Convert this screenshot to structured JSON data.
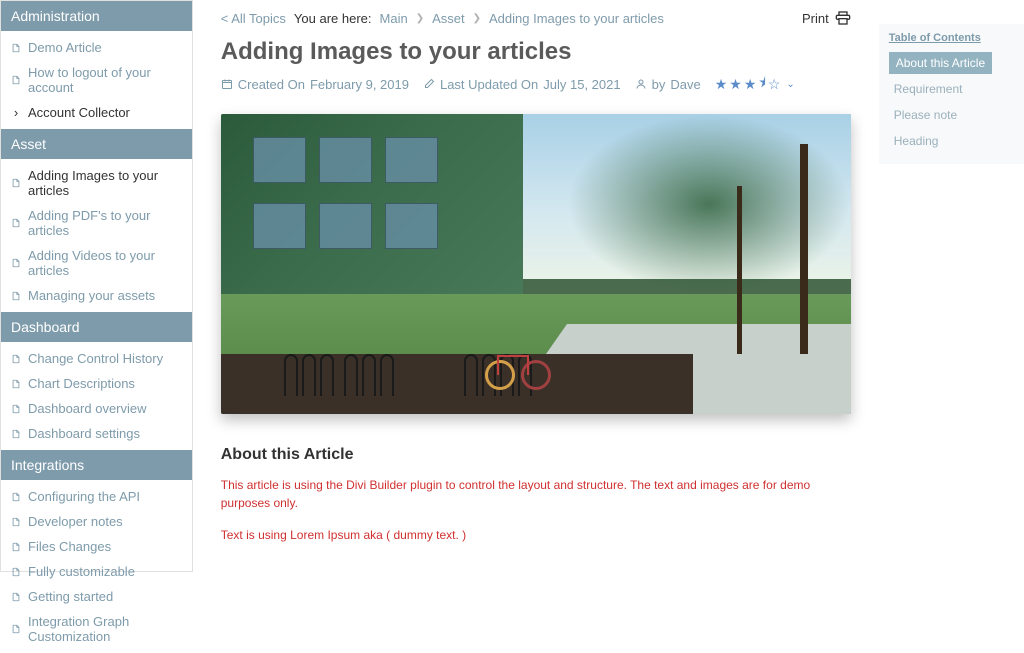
{
  "sidebar": {
    "sections": [
      {
        "title": "Administration",
        "items": [
          {
            "label": "Demo Article",
            "icon": "file"
          },
          {
            "label": "How to logout of your account",
            "icon": "file"
          },
          {
            "label": "Account Collector",
            "icon": "chevron",
            "highlighted": true
          }
        ]
      },
      {
        "title": "Asset",
        "items": [
          {
            "label": "Adding Images to your articles",
            "icon": "file",
            "active": true
          },
          {
            "label": "Adding PDF's to your articles",
            "icon": "file"
          },
          {
            "label": "Adding Videos to your articles",
            "icon": "file"
          },
          {
            "label": "Managing your assets",
            "icon": "file"
          }
        ]
      },
      {
        "title": "Dashboard",
        "items": [
          {
            "label": "Change Control History",
            "icon": "file"
          },
          {
            "label": "Chart Descriptions",
            "icon": "file"
          },
          {
            "label": "Dashboard overview",
            "icon": "file"
          },
          {
            "label": "Dashboard settings",
            "icon": "file"
          }
        ]
      },
      {
        "title": "Integrations",
        "items": [
          {
            "label": "Configuring the API",
            "icon": "file"
          },
          {
            "label": "Developer notes",
            "icon": "file"
          },
          {
            "label": "Files Changes",
            "icon": "file"
          },
          {
            "label": "Fully customizable",
            "icon": "file"
          },
          {
            "label": "Getting started",
            "icon": "file"
          },
          {
            "label": "Integration Graph Customization",
            "icon": "file"
          }
        ]
      }
    ]
  },
  "breadcrumb": {
    "all_topics": "< All Topics",
    "here_label": "You are here:",
    "items": [
      "Main",
      "Asset",
      "Adding Images to your articles"
    ]
  },
  "print_label": "Print",
  "article": {
    "title": "Adding Images to your articles",
    "created_label": "Created On",
    "created_date": "February 9, 2019",
    "updated_label": "Last Updated On",
    "updated_date": "July 15, 2021",
    "by_label": "by",
    "author": "Dave",
    "rating": 3.5
  },
  "content": {
    "heading": "About this Article",
    "p1": "This article is using the Divi Builder plugin to control the layout and structure. The text and images are for demo purposes only.",
    "p2": "Text is using Lorem Ipsum aka ( dummy text. )"
  },
  "toc": {
    "title": "Table of Contents",
    "items": [
      {
        "label": "About this Article",
        "active": true
      },
      {
        "label": "Requirement"
      },
      {
        "label": "Please note"
      },
      {
        "label": "Heading"
      }
    ]
  }
}
